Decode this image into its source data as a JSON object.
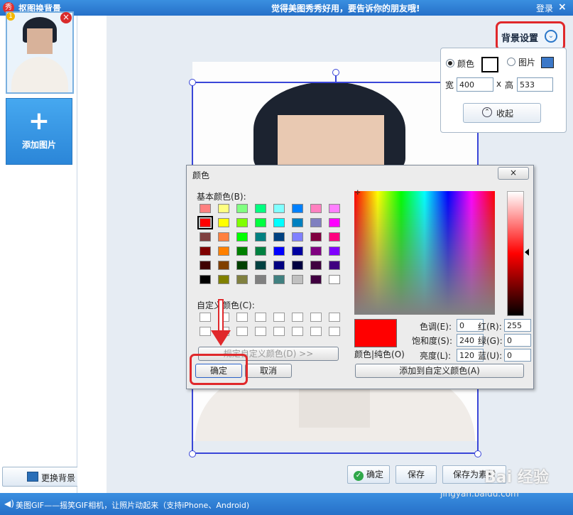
{
  "window": {
    "app_logo": "秀",
    "title": "抠图换背景",
    "promo": "觉得美图秀秀好用，要告诉你的朋友哦!",
    "login": "登录",
    "close": "×"
  },
  "sidebar": {
    "thumb_badge": "1",
    "thumb_delete": "×",
    "add_plus": "+",
    "add_image": "添加图片",
    "change_background": "更换背景"
  },
  "bg_settings": {
    "button_label": "背景设置",
    "expand_icon": "⌄",
    "option_color": "颜色",
    "option_image": "图片",
    "width_label": "宽",
    "width_value": "400",
    "x_sep": "x",
    "height_label": "高",
    "height_value": "533",
    "collapse": "收起",
    "collapse_icon": "⌃",
    "selected_color": "#ffffff"
  },
  "color_dialog": {
    "title": "颜色",
    "close": "×",
    "basic_colors_label": "基本颜色(B):",
    "basic_colors": [
      [
        "#ff8080",
        "#ffff80",
        "#80ff80",
        "#00ff80",
        "#80ffff",
        "#0080ff",
        "#ff80c0",
        "#ff80ff"
      ],
      [
        "#ff0000",
        "#ffff00",
        "#80ff00",
        "#00ff40",
        "#00ffff",
        "#0080c0",
        "#8080c0",
        "#ff00ff"
      ],
      [
        "#804040",
        "#ff8040",
        "#00ff00",
        "#008080",
        "#004080",
        "#8080ff",
        "#800040",
        "#ff0080"
      ],
      [
        "#800000",
        "#ff8000",
        "#008000",
        "#008040",
        "#0000ff",
        "#0000a0",
        "#800080",
        "#8000ff"
      ],
      [
        "#400000",
        "#804000",
        "#004000",
        "#004040",
        "#000080",
        "#000040",
        "#400040",
        "#400080"
      ],
      [
        "#000000",
        "#808000",
        "#808040",
        "#808080",
        "#408080",
        "#c0c0c0",
        "#400040",
        "#ffffff"
      ]
    ],
    "selected_swatch": "#ff0000",
    "custom_colors_label": "自定义颜色(C):",
    "define_custom": "规定自定义颜色(D) >>",
    "ok": "确定",
    "cancel": "取消",
    "color_solid": "颜色|纯色(O)",
    "hue_label": "色调(E):",
    "hue": "0",
    "sat_label": "饱和度(S):",
    "sat": "240",
    "lum_label": "亮度(L):",
    "lum": "120",
    "red_label": "红(R):",
    "red": "255",
    "green_label": "绿(G):",
    "green": "0",
    "blue_label": "蓝(U):",
    "blue": "0",
    "add_custom": "添加到自定义颜色(A)"
  },
  "bottom": {
    "confirm": "确定",
    "confirm_icon": "✓",
    "save": "保存",
    "save_as_template": "保存为素材"
  },
  "status": {
    "icon": "◀)",
    "text": "美图GIF——摇笑GIF相机，让照片动起来（支持iPhone、Android)"
  },
  "watermark": {
    "brand": "Bai 经验",
    "url": "jingyan.baidu.com"
  }
}
